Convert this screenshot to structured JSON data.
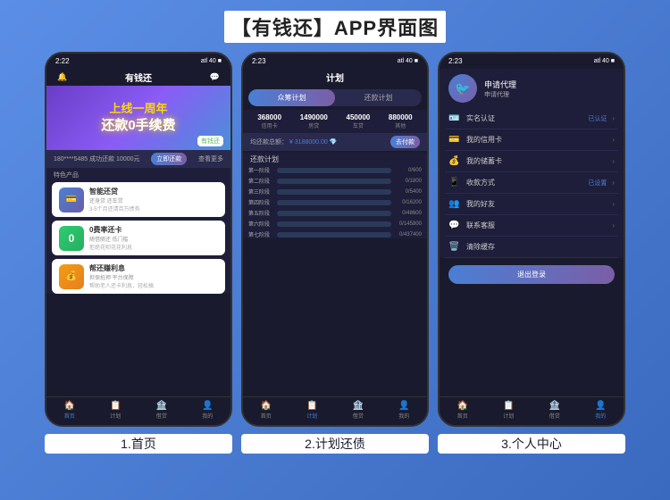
{
  "page": {
    "title": "【有钱还】APP界面图",
    "bg_color": "#4a7fd4"
  },
  "phones": [
    {
      "id": "phone1",
      "caption": "1.首页",
      "status_time": "2:22",
      "signal": "atl 40",
      "header_title": "有钱还",
      "banner_line1": "上线一周年",
      "banner_line2": "还款0手续费",
      "banner_logo": "有钱还",
      "notify_left": "180****5485   成功还款 10000元",
      "notify_btn": "立即还款",
      "notify_right": "查看更多",
      "section_title": "特色产品",
      "products": [
        {
          "name": "智能还贷",
          "desc": "还身贷 还车贷",
          "desc2": "3-5个月还清百万债务",
          "color": "blue",
          "icon": "💳"
        },
        {
          "name": "0费率还卡",
          "desc": "随借随还 低门槛",
          "desc2": "拒绝花呗花花利息",
          "color": "green",
          "icon": "0"
        },
        {
          "name": "帮还赚利息",
          "desc": "担保抵押 平台保障",
          "desc2": "帮助老人还卡利息，轻松搞",
          "color": "orange",
          "icon": "💰"
        }
      ],
      "nav_items": [
        {
          "icon": "🏠",
          "label": "首页",
          "active": true
        },
        {
          "icon": "📋",
          "label": "计划",
          "active": false
        },
        {
          "icon": "🏦",
          "label": "借贷",
          "active": false
        },
        {
          "icon": "👤",
          "label": "我的",
          "active": false
        }
      ]
    },
    {
      "id": "phone2",
      "caption": "2.计划还债",
      "status_time": "2:23",
      "signal": "atl 40",
      "header_title": "计划",
      "tabs": [
        {
          "label": "众筹计划",
          "active": true
        },
        {
          "label": "还款计划",
          "active": false
        }
      ],
      "amounts": [
        {
          "val": "368000",
          "label": "信用卡"
        },
        {
          "val": "1490000",
          "label": "房贷"
        },
        {
          "val": "450000",
          "label": "车贷"
        },
        {
          "val": "880000",
          "label": "其他"
        }
      ],
      "total_label": "均还款总额：",
      "total_val": "¥ 3188000.00",
      "go_pay": "去付款",
      "plan_title": "还款计划",
      "plan_rows": [
        {
          "stage": "第一阶段",
          "fill": 0,
          "val": "0/600"
        },
        {
          "stage": "第二阶段",
          "fill": 0,
          "val": "0/1800"
        },
        {
          "stage": "第三阶段",
          "fill": 0,
          "val": "0/5400"
        },
        {
          "stage": "第四阶段",
          "fill": 0,
          "val": "0/16200"
        },
        {
          "stage": "第五阶段",
          "fill": 0,
          "val": "0/48600"
        },
        {
          "stage": "第六阶段",
          "fill": 0,
          "val": "0/145800"
        },
        {
          "stage": "第七阶段",
          "fill": 0,
          "val": "0/437400"
        }
      ],
      "nav_items": [
        {
          "icon": "🏠",
          "label": "首页",
          "active": false
        },
        {
          "icon": "📋",
          "label": "计划",
          "active": true
        },
        {
          "icon": "🏦",
          "label": "借贷",
          "active": false
        },
        {
          "icon": "👤",
          "label": "我的",
          "active": false
        }
      ]
    },
    {
      "id": "phone3",
      "caption": "3.个人中心",
      "status_time": "2:23",
      "signal": "atl 40",
      "avatar_icon": "🐦",
      "user_name": "申请代理",
      "user_sub": "申请代理",
      "menu_items": [
        {
          "icon": "🪪",
          "label": "实名认证",
          "badge": "已认证",
          "arrow": true
        },
        {
          "icon": "💳",
          "label": "我的信用卡",
          "badge": "",
          "arrow": true
        },
        {
          "icon": "💰",
          "label": "我的储蓄卡",
          "badge": "",
          "arrow": true
        },
        {
          "icon": "📱",
          "label": "收款方式",
          "badge": "已设置",
          "arrow": true
        },
        {
          "icon": "👥",
          "label": "我的好友",
          "badge": "",
          "arrow": true
        },
        {
          "icon": "💬",
          "label": "联系客服",
          "badge": "",
          "arrow": true
        },
        {
          "icon": "🗑️",
          "label": "清除缓存",
          "badge": "",
          "arrow": false
        }
      ],
      "logout_label": "退出登录",
      "nav_items": [
        {
          "icon": "🏠",
          "label": "首页",
          "active": false
        },
        {
          "icon": "📋",
          "label": "计划",
          "active": false
        },
        {
          "icon": "🏦",
          "label": "借贷",
          "active": false
        },
        {
          "icon": "👤",
          "label": "我的",
          "active": true
        }
      ]
    }
  ]
}
